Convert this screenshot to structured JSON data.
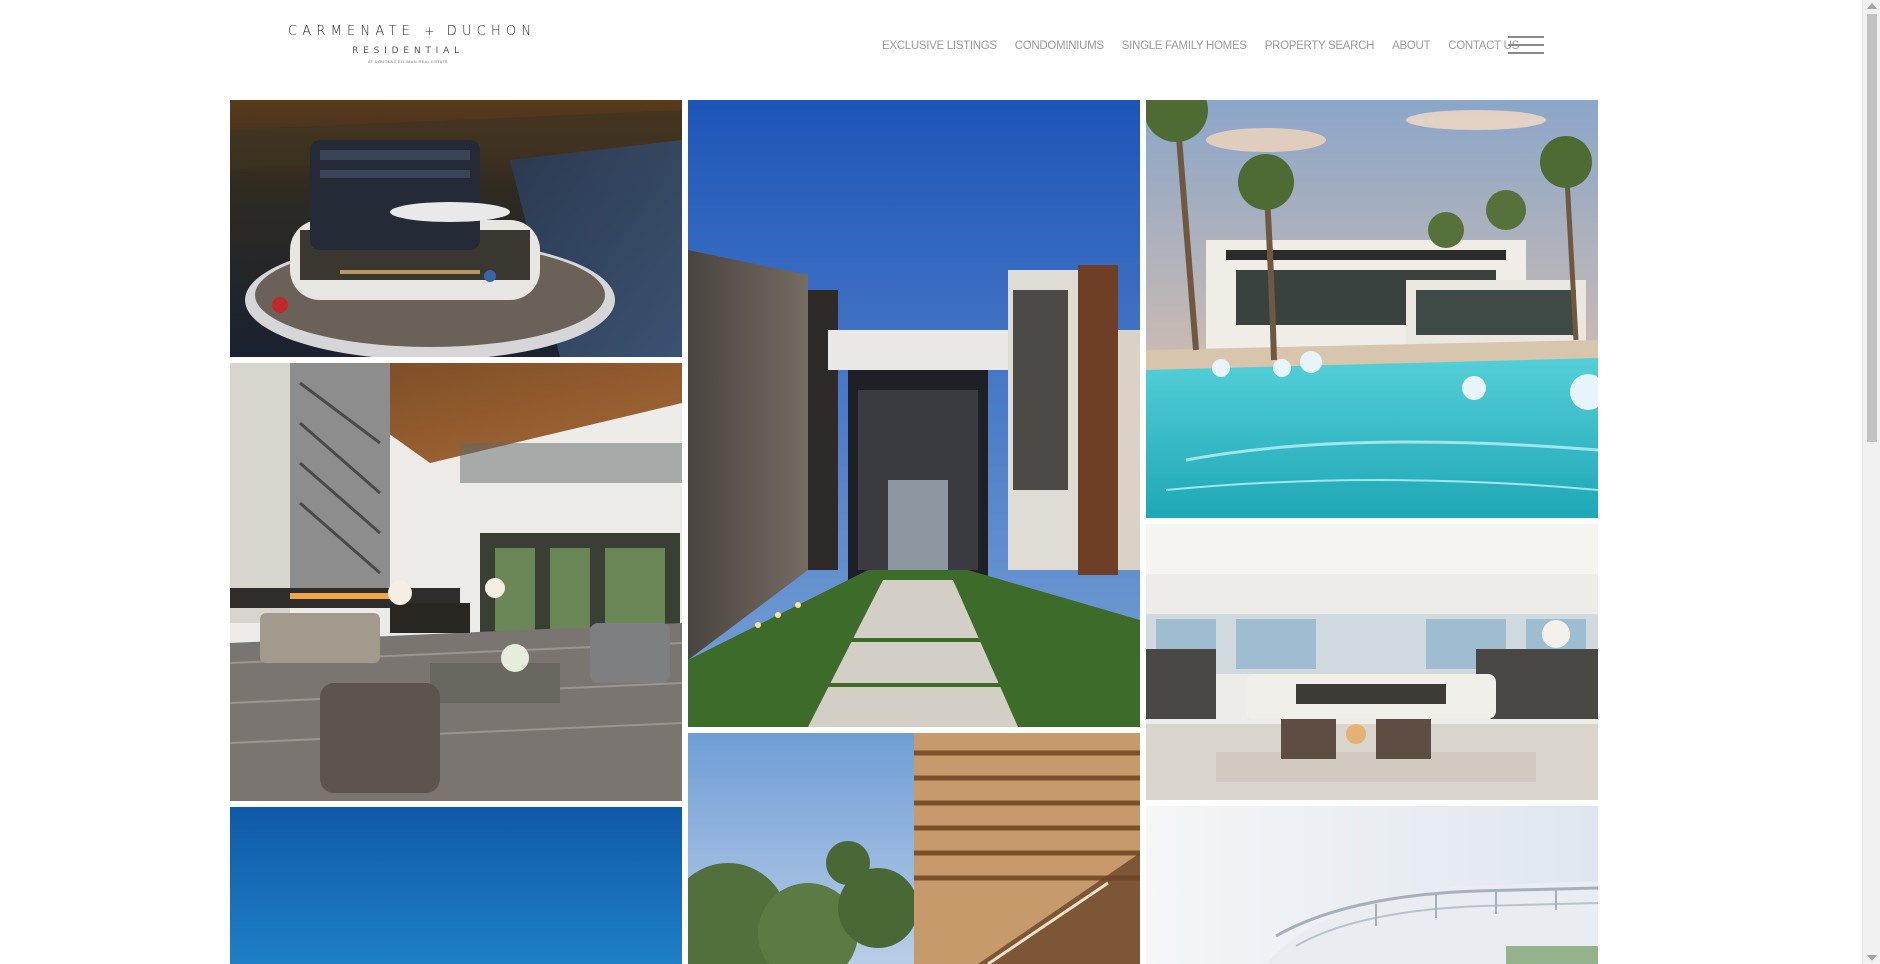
{
  "brand": {
    "name_left": "CARMENATE",
    "plus": "+",
    "name_right": "DUCHON",
    "sub": "RESIDENTIAL",
    "tiny": "AT DOUGLAS ELLIMAN REAL ESTATE"
  },
  "nav": {
    "items": [
      {
        "label": "EXCLUSIVE LISTINGS"
      },
      {
        "label": "CONDOMINIUMS"
      },
      {
        "label": "SINGLE FAMILY HOMES"
      },
      {
        "label": "PROPERTY SEARCH"
      },
      {
        "label": "ABOUT"
      },
      {
        "label": "CONTACT US"
      }
    ],
    "menu_icon": "hamburger-menu-icon"
  },
  "gallery": {
    "tiles": [
      {
        "name": "aerial-penthouse-photo"
      },
      {
        "name": "modern-entrance-photo"
      },
      {
        "name": "pool-villa-photo"
      },
      {
        "name": "living-room-fireplace-photo"
      },
      {
        "name": "oceanfront-living-room-photo"
      },
      {
        "name": "blue-sky-photo"
      },
      {
        "name": "tropical-wood-slats-photo"
      },
      {
        "name": "white-yacht-deck-photo"
      }
    ]
  },
  "colors": {
    "nav_text": "#9a9a9a",
    "logo_text": "#2a2a2a"
  }
}
